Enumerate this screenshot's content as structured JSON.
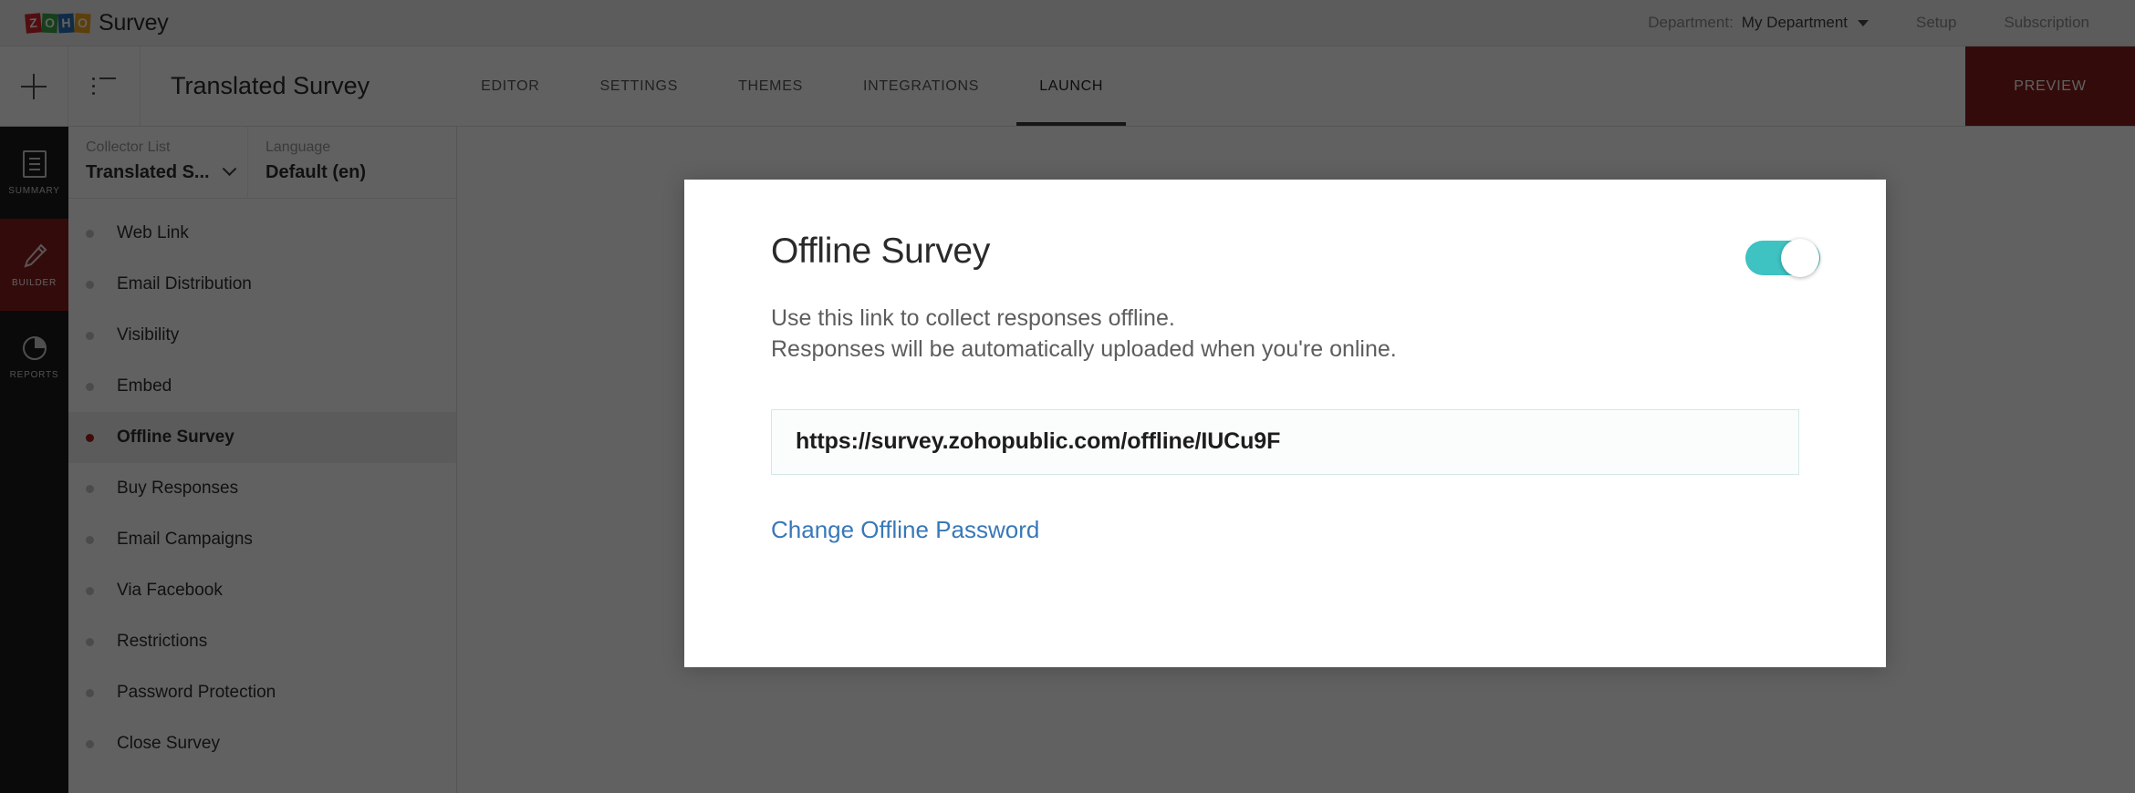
{
  "topbar": {
    "brand_letters": [
      "Z",
      "O",
      "H",
      "O"
    ],
    "brand_name": "Survey",
    "department_label": "Department:",
    "department_value": "My Department",
    "setup_link": "Setup",
    "subscription_link": "Subscription"
  },
  "header": {
    "survey_title": "Translated Survey",
    "tabs": [
      {
        "label": "EDITOR",
        "active": false
      },
      {
        "label": "SETTINGS",
        "active": false
      },
      {
        "label": "THEMES",
        "active": false
      },
      {
        "label": "INTEGRATIONS",
        "active": false
      },
      {
        "label": "LAUNCH",
        "active": true
      }
    ],
    "preview_button": "PREVIEW"
  },
  "rail": {
    "items": [
      {
        "label": "SUMMARY",
        "icon": "document-icon",
        "active": false
      },
      {
        "label": "BUILDER",
        "icon": "pencil-icon",
        "active": true
      },
      {
        "label": "REPORTS",
        "icon": "pie-chart-icon",
        "active": false
      }
    ]
  },
  "collector": {
    "collector_list_title": "Collector List",
    "collector_list_value": "Translated S...",
    "language_title": "Language",
    "language_value": "Default (en)",
    "items": [
      {
        "label": "Web Link",
        "active": false
      },
      {
        "label": "Email Distribution",
        "active": false
      },
      {
        "label": "Visibility",
        "active": false
      },
      {
        "label": "Embed",
        "active": false
      },
      {
        "label": "Offline Survey",
        "active": true
      },
      {
        "label": "Buy Responses",
        "active": false
      },
      {
        "label": "Email Campaigns",
        "active": false
      },
      {
        "label": "Via Facebook",
        "active": false
      },
      {
        "label": "Restrictions",
        "active": false
      },
      {
        "label": "Password Protection",
        "active": false
      },
      {
        "label": "Close Survey",
        "active": false
      }
    ]
  },
  "modal": {
    "title": "Offline Survey",
    "toggle_state": "on",
    "description_line1": "Use this link to collect responses offline.",
    "description_line2": "Responses will be automatically uploaded when you're online.",
    "offline_url": "https://survey.zohopublic.com/offline/IUCu9F",
    "change_password_link": "Change Offline Password"
  },
  "colors": {
    "accent_red": "#8a1f1f",
    "toggle_on": "#3ec2c2",
    "link_blue": "#3878b8",
    "rail_bg": "#1c1c1c",
    "active_dot": "#a81f1f"
  }
}
